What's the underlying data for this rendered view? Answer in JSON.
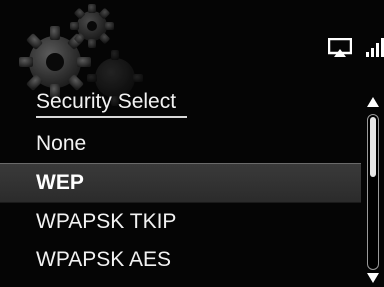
{
  "header": {
    "title": "Security Select"
  },
  "status": {
    "icons": [
      "airplay-icon",
      "signal-strength-icon"
    ]
  },
  "menu": {
    "items": [
      {
        "label": "None",
        "selected": false
      },
      {
        "label": "WEP",
        "selected": true
      },
      {
        "label": "WPAPSK TKIP",
        "selected": false
      },
      {
        "label": "WPAPSK AES",
        "selected": false
      }
    ]
  },
  "scrollbar": {
    "position_fraction": 0.0,
    "visible_fraction": 0.4
  },
  "colors": {
    "background": "#050505",
    "text": "#f2f2f2",
    "selected_bg": "#333333"
  }
}
